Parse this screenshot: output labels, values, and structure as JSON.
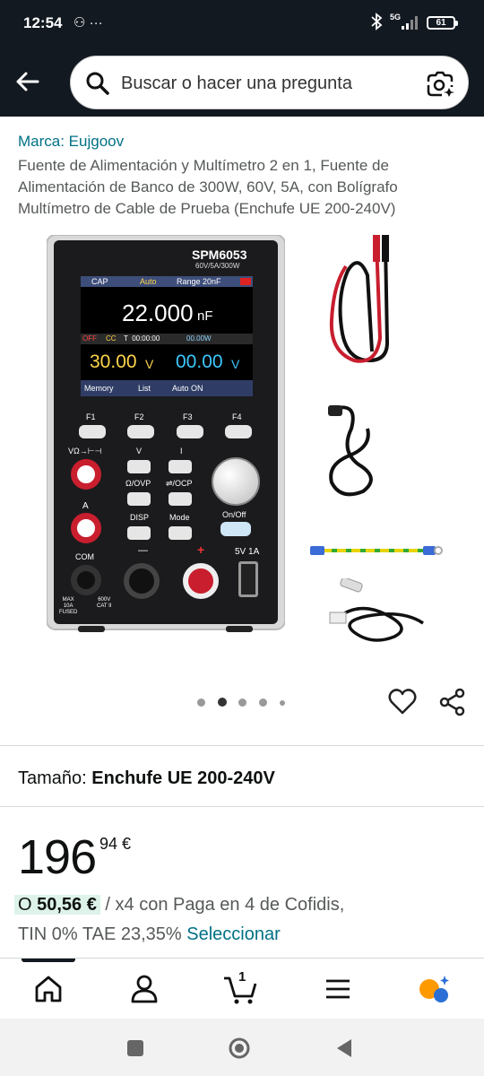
{
  "status_bar": {
    "time": "12:54",
    "notif_icons": "⚇ ···",
    "network": "5G",
    "battery": "61"
  },
  "header": {
    "search_placeholder": "Buscar o hacer una pregunta"
  },
  "product": {
    "brand": "Marca: Eujgoov",
    "title": "Fuente de Alimentación y Multímetro 2 en 1, Fuente de Alimentación de Banco de 300W, 60V, 5A, con Bolígrafo Multímetro de Cable de Prueba (Enchufe UE 200-240V)",
    "device": {
      "model": "SPM6053",
      "spec": "60V/5A/300W",
      "screen_mode": "CAP",
      "screen_auto": "Auto",
      "screen_range": "Range 20nF",
      "reading": "22.000",
      "reading_unit": "nF",
      "status_off": "OFF",
      "status_cc": "CC",
      "status_timer": "T  00:00:00",
      "status_power": "00.00W",
      "voltage": "30.00",
      "voltage_unit": "V",
      "current": "00.00",
      "current_unit": "V",
      "soft_keys": [
        "Memory",
        "List",
        "Auto ON",
        ""
      ],
      "f_keys": [
        "F1",
        "F2",
        "F3",
        "F4"
      ],
      "label_vohm": "VΩ→⊢⊣",
      "label_v": "V",
      "label_i": "I",
      "label_a": "A",
      "label_ovp": "Ω/OVP",
      "label_ocp": "⇌/OCP",
      "label_com": "COM",
      "label_disp": "DISP",
      "label_mode": "Mode",
      "label_onoff": "On/Off",
      "label_minus": "—",
      "label_plus": "+",
      "label_usb": "5V 1A",
      "label_max": "MAX\n10A\nFUSED",
      "label_cat": "600V\nCAT II"
    }
  },
  "gallery": {
    "count": 5,
    "active_index": 1
  },
  "size": {
    "label": "Tamaño:",
    "value": "Enchufe UE 200-240V"
  },
  "price": {
    "whole": "196",
    "fraction": "94 €"
  },
  "financing": {
    "prefix": "O",
    "amount": "50,56 €",
    "text": "/ x4 con Paga en 4 de Cofidis,",
    "line2": "TIN 0% TAE 23,35%",
    "link": "Seleccionar"
  },
  "bottom_nav": {
    "cart_count": "1",
    "accent": "#ff9900"
  },
  "colors": {
    "header_bg": "#131921",
    "link": "#007185",
    "finance_highlight": "#ddf3e9"
  }
}
